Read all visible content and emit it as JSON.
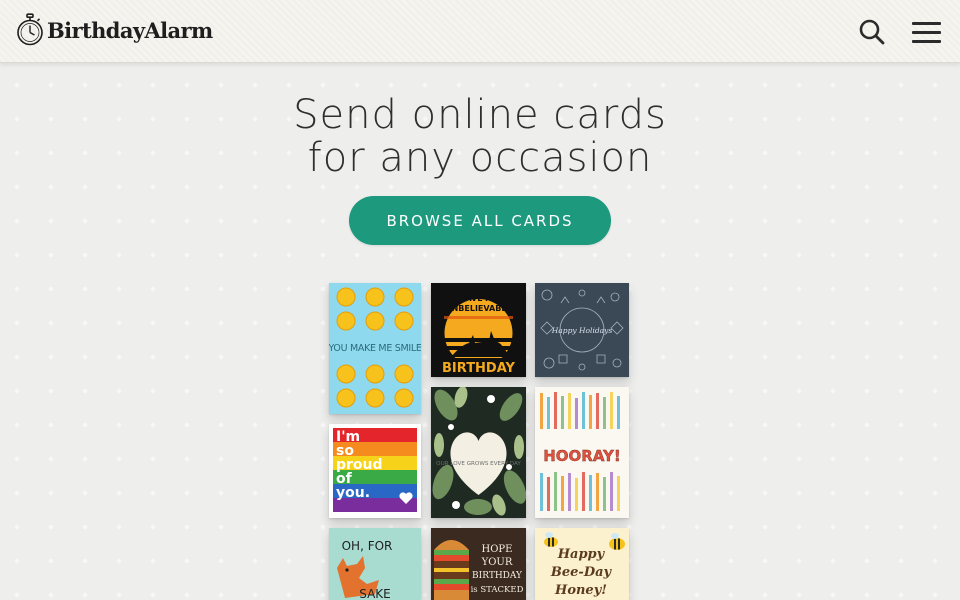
{
  "brand": {
    "name": "BirthdayAlarm"
  },
  "header": {
    "search_icon": "search-icon",
    "menu_icon": "hamburger-menu-icon"
  },
  "hero": {
    "title_line1": "Send online cards",
    "title_line2": "for any occasion",
    "browse_label": "BROWSE ALL CARDS",
    "accent_color": "#1d9a7e"
  },
  "cards": {
    "smile": {
      "text": "YOU MAKE ME SMILE",
      "colors": [
        "#8bd8ec",
        "#f7c21b"
      ]
    },
    "unbelievable": {
      "line1": "HAVE AN",
      "line2": "UNBELIEVABLE",
      "line3": "BIRTHDAY"
    },
    "doodle": {
      "text": "Happy Holidays"
    },
    "proud": {
      "line1": "I'm",
      "line2": "so",
      "line3": "proud",
      "line4": "of",
      "line5": "you."
    },
    "love": {
      "text": "OUR LOVE GROWS EVERY DAY"
    },
    "hooray": {
      "text": "HOORAY!"
    },
    "fox": {
      "line1": "OH, FOR",
      "line2": "SAKE"
    },
    "burger": {
      "line1": "HOPE",
      "line2": "YOUR",
      "line3": "BIRTHDAY",
      "line4": "is STACKED"
    },
    "bee": {
      "line1": "Happy",
      "line2": "Bee-Day",
      "line3": "Honey!"
    }
  }
}
